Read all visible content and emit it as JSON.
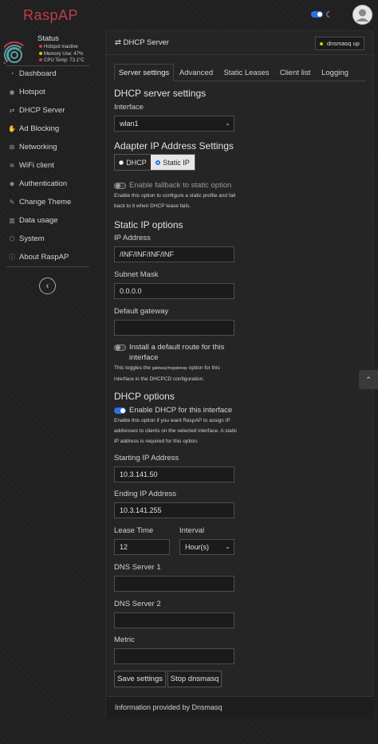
{
  "brand": "RaspAP",
  "colors": {
    "brand": "#c23a4e",
    "accent": "#2f6fe0",
    "status_inactive": "#d63b3b",
    "status_ok": "#c8d000"
  },
  "sidebar": {
    "status_title": "Status",
    "stats": [
      {
        "text": "Hotspot inactive",
        "color": "#d63b3b"
      },
      {
        "text": "Memory Use: 47%",
        "color": "#c8d000"
      },
      {
        "text": "CPU Temp: 73.1°C",
        "color": "#d63b3b"
      }
    ],
    "items": [
      {
        "label": "Dashboard",
        "icon": "tachometer-icon"
      },
      {
        "label": "Hotspot",
        "icon": "dot-circle-icon"
      },
      {
        "label": "DHCP Server",
        "icon": "exchange-icon"
      },
      {
        "label": "Ad Blocking",
        "icon": "hand-icon"
      },
      {
        "label": "Networking",
        "icon": "network-icon"
      },
      {
        "label": "WiFi client",
        "icon": "wifi-icon"
      },
      {
        "label": "Authentication",
        "icon": "user-lock-icon"
      },
      {
        "label": "Change Theme",
        "icon": "paint-brush-icon"
      },
      {
        "label": "Data usage",
        "icon": "chart-bar-icon"
      },
      {
        "label": "System",
        "icon": "cube-icon"
      },
      {
        "label": "About RaspAP",
        "icon": "info-circle-icon"
      }
    ]
  },
  "card": {
    "title": "DHCP Server",
    "badge": "dnsmasq up",
    "footer": "Information provided by Dnsmasq"
  },
  "tabs": [
    "Server settings",
    "Advanced",
    "Static Leases",
    "Client list",
    "Logging"
  ],
  "form": {
    "section_title": "DHCP server settings",
    "interface_label": "Interface",
    "interface_value": "wlan1",
    "adapter_title": "Adapter IP Address Settings",
    "radio_dhcp": "DHCP",
    "radio_static": "Static IP",
    "fallback_label": "Enable fallback to static option",
    "fallback_help": "Enable this option to configure a static profile and fall back to it when DHCP lease fails.",
    "static_title": "Static IP options",
    "ip_label": "IP Address",
    "ip_value": "/INF/INF/INF/INF",
    "subnet_label": "Subnet Mask",
    "subnet_value": "0.0.0.0",
    "gateway_label": "Default gateway",
    "gateway_value": "",
    "route_label": "Install a default route for this interface",
    "route_help_pre": "This toggles the ",
    "route_help_code": "gateway/nogateway",
    "route_help_post": " option for this interface in the DHCPCD configuration.",
    "dhcp_title": "DHCP options",
    "enable_dhcp_label": "Enable DHCP for this interface",
    "enable_dhcp_help": "Enable this option if you want RaspAP to assign IP addresses to clients on the selected interface. A static IP address is required for this option.",
    "start_label": "Starting IP Address",
    "start_value": "10.3.141.50",
    "end_label": "Ending IP Address",
    "end_value": "10.3.141.255",
    "lease_label": "Lease Time",
    "lease_value": "12",
    "interval_label": "Interval",
    "interval_value": "Hour(s)",
    "dns1_label": "DNS Server 1",
    "dns1_value": "",
    "dns2_label": "DNS Server 2",
    "dns2_value": "",
    "metric_label": "Metric",
    "metric_value": "",
    "save_label": "Save settings",
    "stop_label": "Stop dnsmasq"
  }
}
